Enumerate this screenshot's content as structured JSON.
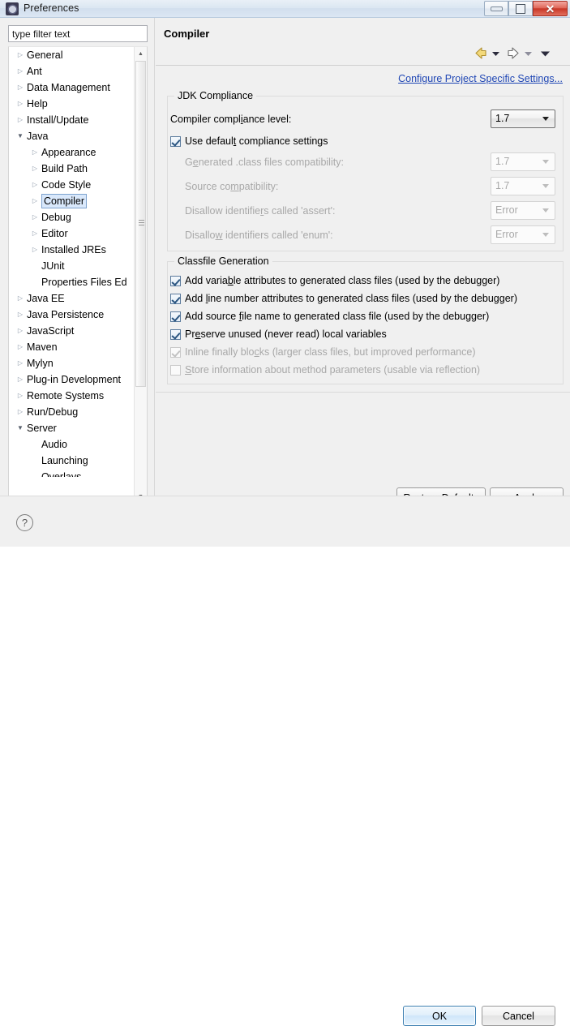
{
  "window": {
    "title": "Preferences",
    "icon": "preferences-icon",
    "controls": {
      "minimize": "minimize-button",
      "maximize": "maximize-button",
      "close_glyph": "✕"
    }
  },
  "sidebar": {
    "filter": {
      "placeholder": "type filter text",
      "value": ""
    },
    "tree": [
      {
        "label": "General",
        "indent": 0,
        "expander": "collapsed",
        "selected": false
      },
      {
        "label": "Ant",
        "indent": 0,
        "expander": "collapsed",
        "selected": false
      },
      {
        "label": "Data Management",
        "indent": 0,
        "expander": "collapsed",
        "selected": false
      },
      {
        "label": "Help",
        "indent": 0,
        "expander": "collapsed",
        "selected": false
      },
      {
        "label": "Install/Update",
        "indent": 0,
        "expander": "collapsed",
        "selected": false
      },
      {
        "label": "Java",
        "indent": 0,
        "expander": "expanded",
        "selected": false
      },
      {
        "label": "Appearance",
        "indent": 1,
        "expander": "collapsed",
        "selected": false
      },
      {
        "label": "Build Path",
        "indent": 1,
        "expander": "collapsed",
        "selected": false
      },
      {
        "label": "Code Style",
        "indent": 1,
        "expander": "collapsed",
        "selected": false
      },
      {
        "label": "Compiler",
        "indent": 1,
        "expander": "collapsed",
        "selected": true
      },
      {
        "label": "Debug",
        "indent": 1,
        "expander": "collapsed",
        "selected": false
      },
      {
        "label": "Editor",
        "indent": 1,
        "expander": "collapsed",
        "selected": false
      },
      {
        "label": "Installed JREs",
        "indent": 1,
        "expander": "collapsed",
        "selected": false
      },
      {
        "label": "JUnit",
        "indent": 1,
        "expander": "none",
        "selected": false
      },
      {
        "label": "Properties Files Ed",
        "indent": 1,
        "expander": "none",
        "selected": false
      },
      {
        "label": "Java EE",
        "indent": 0,
        "expander": "collapsed",
        "selected": false
      },
      {
        "label": "Java Persistence",
        "indent": 0,
        "expander": "collapsed",
        "selected": false
      },
      {
        "label": "JavaScript",
        "indent": 0,
        "expander": "collapsed",
        "selected": false
      },
      {
        "label": "Maven",
        "indent": 0,
        "expander": "collapsed",
        "selected": false
      },
      {
        "label": "Mylyn",
        "indent": 0,
        "expander": "collapsed",
        "selected": false
      },
      {
        "label": "Plug-in Development",
        "indent": 0,
        "expander": "collapsed",
        "selected": false
      },
      {
        "label": "Remote Systems",
        "indent": 0,
        "expander": "collapsed",
        "selected": false
      },
      {
        "label": "Run/Debug",
        "indent": 0,
        "expander": "collapsed",
        "selected": false
      },
      {
        "label": "Server",
        "indent": 0,
        "expander": "expanded",
        "selected": false
      },
      {
        "label": "Audio",
        "indent": 1,
        "expander": "none",
        "selected": false
      },
      {
        "label": "Launching",
        "indent": 1,
        "expander": "none",
        "selected": false
      },
      {
        "label": "Overlays",
        "indent": 1,
        "expander": "none",
        "selected": false
      }
    ]
  },
  "pane": {
    "title": "Compiler",
    "nav": {
      "back": "back-arrow-icon",
      "back_menu": "back-dropdown-icon",
      "forward": "forward-arrow-icon",
      "forward_menu": "forward-dropdown-icon",
      "view_menu": "view-menu-icon"
    },
    "project_specific_link": "Configure Project Specific Settings...",
    "jdk_compliance": {
      "title": "JDK Compliance",
      "rows": [
        {
          "label": "Compiler compliance level:",
          "mnemonic": "i",
          "value": "1.7",
          "enabled": true
        },
        {
          "label": "Generated .class files compatibility:",
          "mnemonic": "e",
          "value": "1.7",
          "enabled": false
        },
        {
          "label": "Source compatibility:",
          "mnemonic": "m",
          "value": "1.7",
          "enabled": false
        },
        {
          "label": "Disallow identifiers called 'assert':",
          "mnemonic": "r",
          "value": "Error",
          "enabled": false
        },
        {
          "label": "Disallow identifiers called 'enum':",
          "mnemonic": "w",
          "value": "Error",
          "enabled": false
        }
      ],
      "use_defaults": {
        "label": "Use default compliance settings",
        "mnemonic": "t",
        "checked": true,
        "enabled": true
      }
    },
    "classfile_generation": {
      "title": "Classfile Generation",
      "options": [
        {
          "label": "Add variable attributes to generated class files (used by the debugger)",
          "mnemonic": "b",
          "checked": true,
          "enabled": true
        },
        {
          "label": "Add line number attributes to generated class files (used by the debugger)",
          "mnemonic": "l",
          "checked": true,
          "enabled": true
        },
        {
          "label": "Add source file name to generated class file (used by the debugger)",
          "mnemonic": "f",
          "checked": true,
          "enabled": true
        },
        {
          "label": "Preserve unused (never read) local variables",
          "mnemonic": "e",
          "checked": true,
          "enabled": true
        },
        {
          "label": "Inline finally blocks (larger class files, but improved performance)",
          "mnemonic": "c",
          "checked": true,
          "enabled": false
        },
        {
          "label": "Store information about method parameters (usable via reflection)",
          "mnemonic": "S",
          "checked": false,
          "enabled": false
        }
      ]
    },
    "buttons": {
      "restore_defaults": "Restore Defaults",
      "apply": "Apply"
    }
  },
  "footer": {
    "help": "?",
    "ok": "OK",
    "cancel": "Cancel"
  },
  "colors": {
    "link": "#1f46b4",
    "selection_bg": "#d9e8fb",
    "selection_border": "#7da2ce",
    "disabled_text": "#a8a8a8",
    "close_button": "#c83828",
    "ok_focus_border": "#3c7fb1"
  }
}
